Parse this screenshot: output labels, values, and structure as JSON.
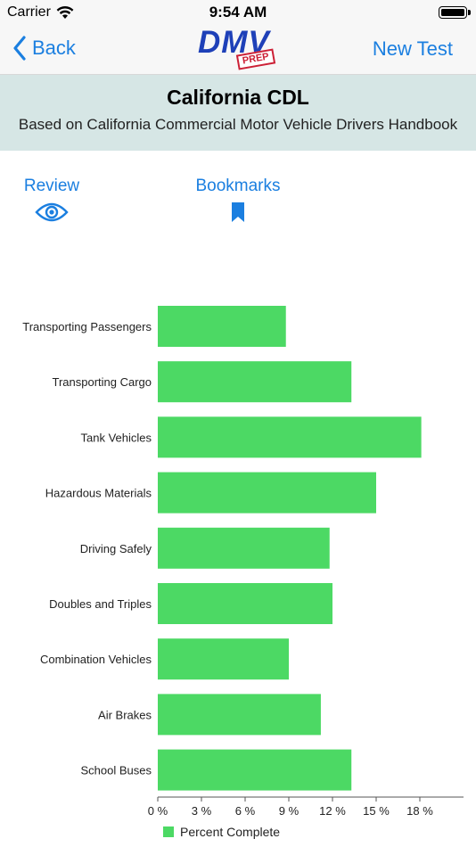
{
  "status_bar": {
    "carrier": "Carrier",
    "time": "9:54 AM"
  },
  "nav": {
    "back_label": "Back",
    "logo_text": "DMV",
    "logo_badge": "PREP",
    "right_label": "New Test"
  },
  "header": {
    "title": "California CDL",
    "subtitle": "Based on California Commercial Motor Vehicle Drivers Handbook"
  },
  "tools": {
    "review_label": "Review",
    "bookmarks_label": "Bookmarks"
  },
  "colors": {
    "accent": "#1b7fe0",
    "bar": "#4cd964",
    "band": "#d6e6e5"
  },
  "chart_data": {
    "type": "bar",
    "orientation": "horizontal",
    "categories": [
      "Transporting Passengers",
      "Transporting Cargo",
      "Tank Vehicles",
      "Hazardous Materials",
      "Driving Safely",
      "Doubles and Triples",
      "Combination Vehicles",
      "Air Brakes",
      "School Buses"
    ],
    "values": [
      8.8,
      13.3,
      18.1,
      15.0,
      11.8,
      12.0,
      9.0,
      11.2,
      13.3
    ],
    "series_name": "Percent Complete",
    "xlim": [
      0,
      21
    ],
    "xticks": [
      0,
      3,
      6,
      9,
      12,
      15,
      18
    ],
    "xtick_labels": [
      "0 %",
      "3 %",
      "6 %",
      "9 %",
      "12 %",
      "15 %",
      "18 %"
    ],
    "title": "",
    "xlabel": "",
    "ylabel": "",
    "legend": "bottom-left",
    "grid": false
  }
}
